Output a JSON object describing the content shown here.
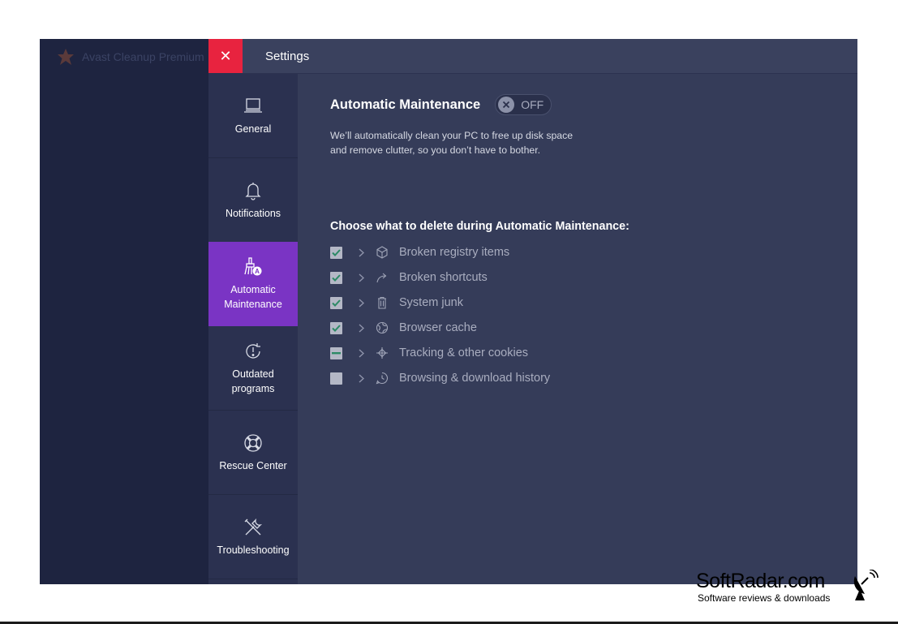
{
  "background_app": {
    "title": "Avast Cleanup Premium"
  },
  "window": {
    "title": "Settings",
    "close_glyph": "✕"
  },
  "sidebar": {
    "items": [
      {
        "label": "General",
        "icon": "laptop-icon",
        "active": false
      },
      {
        "label": "Notifications",
        "icon": "bell-icon",
        "active": false
      },
      {
        "label": "Automatic\nMaintenance",
        "icon": "maintenance-icon",
        "active": true
      },
      {
        "label": "Outdated\nprograms",
        "icon": "refresh-alert-icon",
        "active": false
      },
      {
        "label": "Rescue Center",
        "icon": "lifebuoy-icon",
        "active": false
      },
      {
        "label": "Troubleshooting",
        "icon": "tools-icon",
        "active": false
      }
    ]
  },
  "main": {
    "heading": "Automatic Maintenance",
    "toggle": {
      "label": "OFF",
      "on": false
    },
    "description_line1": "We’ll automatically clean your PC to free up disk space",
    "description_line2": "and remove clutter, so you don’t have to bother.",
    "subheading": "Choose what to delete during Automatic Maintenance:",
    "options": [
      {
        "label": "Broken registry items",
        "state": "checked",
        "icon": "registry-cube-icon"
      },
      {
        "label": "Broken shortcuts",
        "state": "checked",
        "icon": "shortcut-arrow-icon"
      },
      {
        "label": "System junk",
        "state": "checked",
        "icon": "trash-icon"
      },
      {
        "label": "Browser cache",
        "state": "checked",
        "icon": "globe-icon"
      },
      {
        "label": "Tracking & other cookies",
        "state": "indeterminate",
        "icon": "crosshair-icon"
      },
      {
        "label": "Browsing & download history",
        "state": "unchecked",
        "icon": "history-bubble-icon"
      }
    ]
  },
  "watermark": {
    "title": "SoftRadar.com",
    "subtitle": "Software reviews & downloads"
  },
  "colors": {
    "accent_active": "#7a34c4",
    "close_button": "#e8233f",
    "panel_bg": "#353c59",
    "sidebar_bg": "#2b3150",
    "checkbox": "#b4b8c6",
    "check_mark": "#2d8a66"
  }
}
